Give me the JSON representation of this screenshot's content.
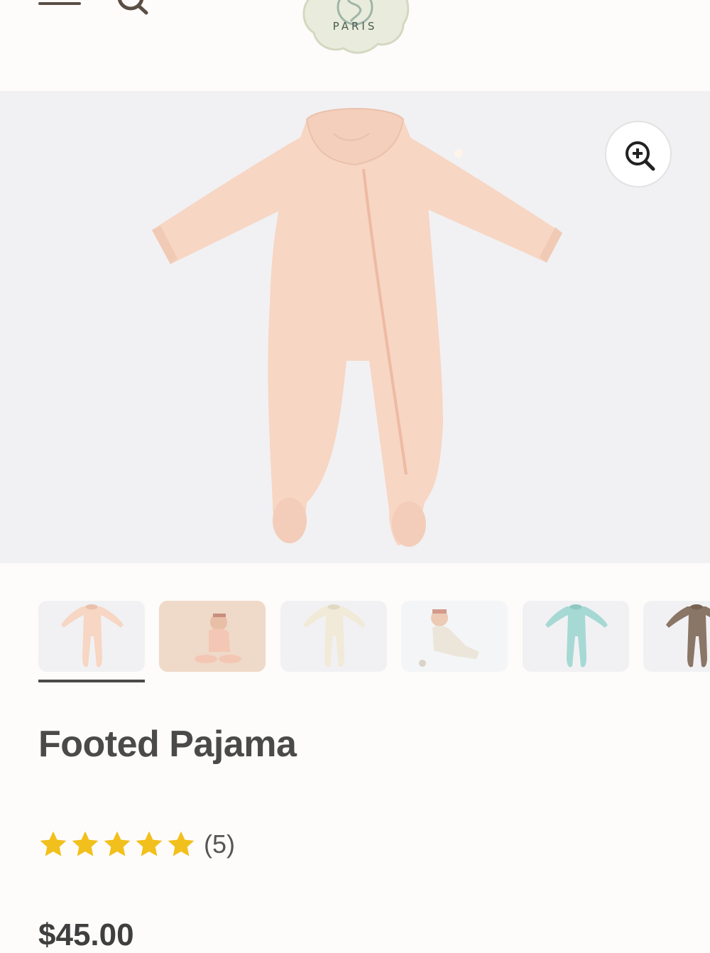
{
  "header": {
    "logo_text": "PARIS",
    "icons": {
      "menu": "hamburger-menu-icon",
      "search": "search-icon"
    }
  },
  "hero": {
    "zoom_icon": "zoom-in-icon",
    "background_color": "#f1f1f4",
    "product_color": "#f7d6c3"
  },
  "thumbnails": {
    "active_index": 0,
    "items": [
      {
        "name": "pink-footed-pajama",
        "color": "#f7d6c3"
      },
      {
        "name": "baby-wearing-pink-pajama",
        "color": "#efd9c9"
      },
      {
        "name": "cream-footed-pajama",
        "color": "#f1ead8"
      },
      {
        "name": "baby-wearing-cream-pajama",
        "color": "#ece6da"
      },
      {
        "name": "mint-footed-pajama",
        "color": "#a7d9d4"
      },
      {
        "name": "brown-footed-pajama",
        "color": "#8a7666"
      }
    ]
  },
  "product": {
    "title": "Footed Pajama",
    "rating": 5,
    "rating_max": 5,
    "review_count": "(5)",
    "price": "$45.00"
  },
  "colors": {
    "star": "#f2c01d",
    "text": "#4a4a4a",
    "page_bg": "#fdfcfa"
  }
}
